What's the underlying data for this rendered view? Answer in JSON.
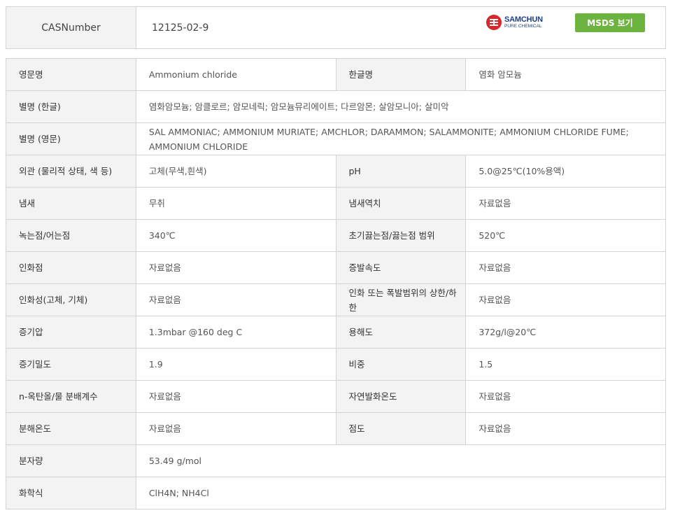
{
  "cas": {
    "label": "CASNumber",
    "value": "12125-02-9",
    "brand_name": "SAMCHUN",
    "brand_sub": "PURE CHEMICAL",
    "msds_button": "MSDS 보기"
  },
  "colors": {
    "button_green": "#6cb33f",
    "label_bg": "#f3f3f3",
    "border": "#d4d4d4",
    "brand_red": "#d7262c",
    "brand_blue": "#1d3e8a"
  },
  "rows": [
    {
      "l1": "영문명",
      "v1": "Ammonium chloride",
      "l2": "한글명",
      "v2": "염화 암모늄"
    },
    {
      "l1": "별명 (한글)",
      "v1": "염화암모늄; 암클로르; 암모네릭; 암모늄뮤리에이트; 다르암몬; 살암모니아; 살미악"
    },
    {
      "l1": "별명 (영문)",
      "v1": "SAL AMMONIAC; AMMONIUM MURIATE; AMCHLOR; DARAMMON; SALAMMONITE; AMMONIUM CHLORIDE FUME; AMMONIUM CHLORIDE"
    },
    {
      "l1": "외관 (물리적 상태, 색 등)",
      "v1": "고체(무색,흰색)",
      "l2": "pH",
      "v2": "5.0@25℃(10%용액)"
    },
    {
      "l1": "냄새",
      "v1": "무취",
      "l2": "냄새역치",
      "v2": "자료없음"
    },
    {
      "l1": "녹는점/어는점",
      "v1": "340℃",
      "l2": "초기끓는점/끓는점 범위",
      "v2": "520℃"
    },
    {
      "l1": "인화점",
      "v1": "자료없음",
      "l2": "증발속도",
      "v2": "자료없음"
    },
    {
      "l1": "인화성(고체, 기체)",
      "v1": "자료없음",
      "l2": "인화 또는 폭발범위의 상한/하한",
      "v2": "자료없음"
    },
    {
      "l1": "증기압",
      "v1": "1.3mbar @160 deg C",
      "l2": "용해도",
      "v2": "372g/l@20℃"
    },
    {
      "l1": "증기밀도",
      "v1": "1.9",
      "l2": "비중",
      "v2": "1.5"
    },
    {
      "l1": "n-옥탄올/물 분배계수",
      "v1": "자료없음",
      "l2": "자연발화온도",
      "v2": "자료없음"
    },
    {
      "l1": "분해온도",
      "v1": "자료없음",
      "l2": "점도",
      "v2": "자료없음"
    },
    {
      "l1": "분자량",
      "v1": "53.49 g/mol"
    },
    {
      "l1": "화학식",
      "v1": "ClH4N; NH4Cl"
    }
  ]
}
